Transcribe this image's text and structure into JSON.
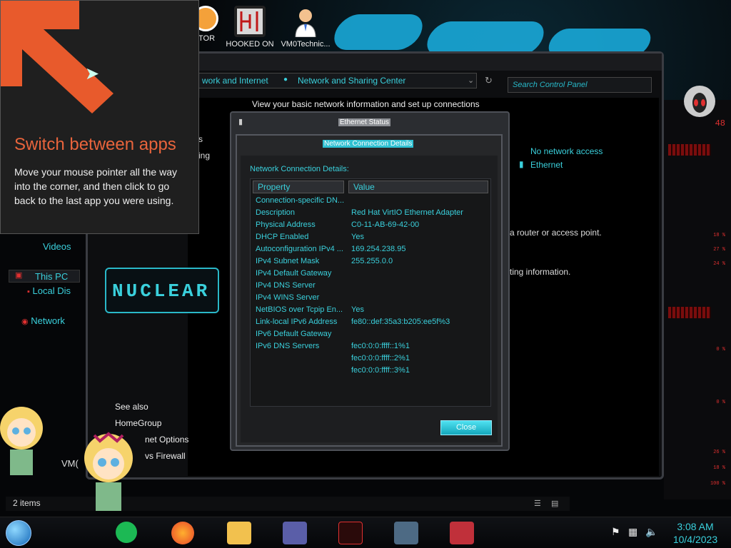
{
  "desktop": {
    "icons": [
      {
        "label": "ITOR"
      },
      {
        "label": "HOOKED ON"
      },
      {
        "label": "VM0Technic..."
      }
    ],
    "vm_label": "VM("
  },
  "tip": {
    "title": "Switch between apps",
    "body": "Move your mouse pointer all the way into the corner, and then click to go back to the last app you were using."
  },
  "explorer": {
    "breadcrumb_prev": "work and Internet",
    "breadcrumb_current": "Network and Sharing Center",
    "search_placeholder": "Search Control Panel",
    "heading": "View your basic network information and set up connections",
    "network_access": "No network access",
    "network_adapter": "Ethernet",
    "router_text": "a router or access point.",
    "ting_text": "ting information.",
    "truncated_s": "s",
    "truncated_ing": "ing",
    "see_also": "See also",
    "see_also_items": [
      "HomeGroup",
      "net Options",
      "vs Firewall"
    ],
    "nav": {
      "videos": "Videos",
      "this_pc": "This PC",
      "local_disk": "Local Dis",
      "network": "Network"
    },
    "status_bar": "2 items",
    "nuclear_logo": "NUCLEAR"
  },
  "dialog": {
    "status_title": "Ethernet Status",
    "details_title": "Network Connection Details",
    "section_label": "Network Connection Details:",
    "col_property": "Property",
    "col_value": "Value",
    "rows": [
      {
        "property": "Connection-specific DN...",
        "value": ""
      },
      {
        "property": "Description",
        "value": "Red Hat VirtIO Ethernet Adapter"
      },
      {
        "property": "Physical Address",
        "value": "C0-11-AB-69-42-00"
      },
      {
        "property": "DHCP Enabled",
        "value": "Yes"
      },
      {
        "property": "Autoconfiguration IPv4 ...",
        "value": "169.254.238.95"
      },
      {
        "property": "IPv4 Subnet Mask",
        "value": "255.255.0.0"
      },
      {
        "property": "IPv4 Default Gateway",
        "value": ""
      },
      {
        "property": "IPv4 DNS Server",
        "value": ""
      },
      {
        "property": "IPv4 WINS Server",
        "value": ""
      },
      {
        "property": "NetBIOS over Tcpip En...",
        "value": "Yes"
      },
      {
        "property": "Link-local IPv6 Address",
        "value": "fe80::def:35a3:b205:ee5f%3"
      },
      {
        "property": "IPv6 Default Gateway",
        "value": ""
      },
      {
        "property": "IPv6 DNS Servers",
        "value": "fec0:0:0:ffff::1%1"
      },
      {
        "property": "",
        "value": "fec0:0:0:ffff::2%1"
      },
      {
        "property": "",
        "value": "fec0:0:0:ffff::3%1"
      }
    ],
    "close_label": "Close"
  },
  "gadget": {
    "numbers": [
      "48",
      "18 %",
      "27 %",
      "24 %",
      "0 %",
      "0 %",
      "26 %",
      "18 %",
      "100 %"
    ]
  },
  "taskbar": {
    "time": "3:08 AM",
    "date": "10/4/2023"
  },
  "colors": {
    "accent": "#3ad0dc",
    "tip_title": "#e8643c",
    "arrow": "#e85a2c",
    "gadget_red": "#e03030"
  }
}
